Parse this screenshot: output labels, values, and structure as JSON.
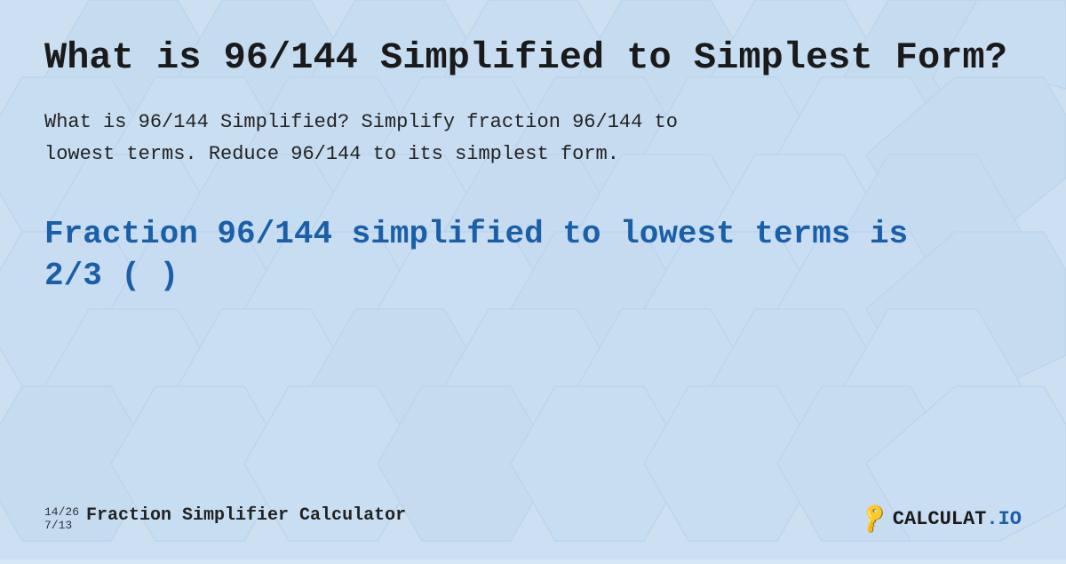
{
  "page": {
    "title": "What is 96/144 Simplified to Simplest Form?",
    "description_line1": "What is 96/144 Simplified? Simplify fraction 96/144 to",
    "description_line2": "lowest terms. Reduce 96/144 to its simplest form.",
    "result_line1": "Fraction 96/144 simplified to lowest terms is",
    "result_line2": "2/3 ( )",
    "footer": {
      "fraction_top": "14/26",
      "fraction_bottom": "7/13",
      "brand_name": "Fraction Simplifier Calculator",
      "logo_text": "CALCULAT.IO"
    }
  },
  "colors": {
    "background": "#cde0f2",
    "title_color": "#1a1a1a",
    "result_color": "#1a5fa8",
    "text_color": "#222222"
  }
}
